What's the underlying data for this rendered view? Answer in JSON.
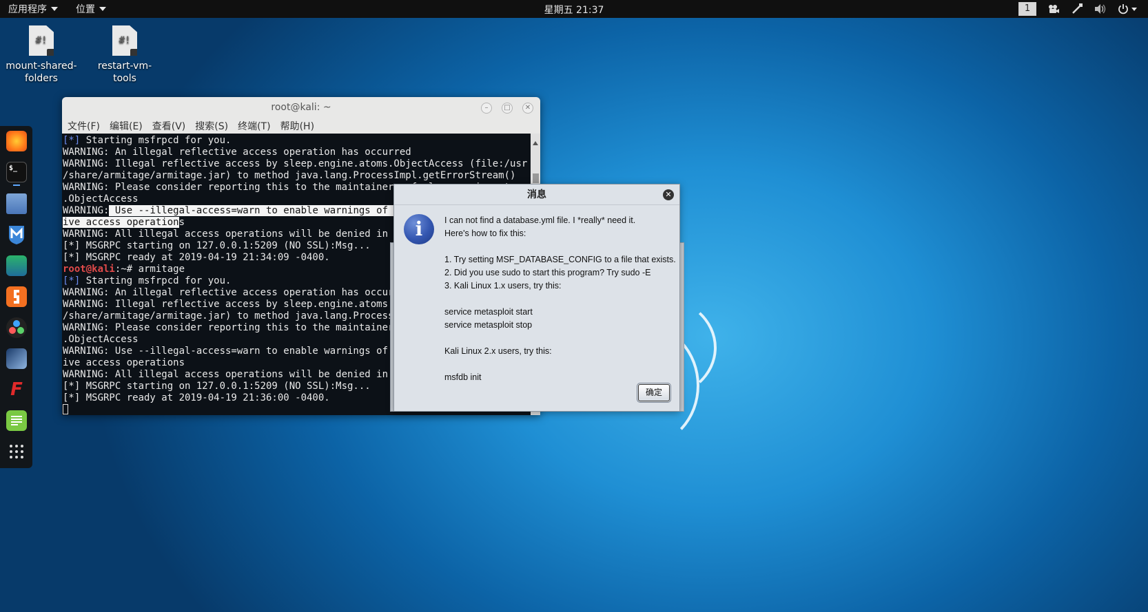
{
  "topbar": {
    "apps_menu": "应用程序",
    "places_menu": "位置",
    "clock": "星期五 21:37",
    "workspace": "1"
  },
  "desktop": {
    "icons": [
      {
        "label": "mount-shared-\nfolders"
      },
      {
        "label": "restart-vm-\ntools"
      }
    ],
    "file_glyph": "#!"
  },
  "terminal": {
    "title": "root@kali: ~",
    "menu": [
      "文件(F)",
      "编辑(E)",
      "查看(V)",
      "搜索(S)",
      "终端(T)",
      "帮助(H)"
    ],
    "lines": [
      {
        "parts": [
          {
            "t": "[*]",
            "c": "blue"
          },
          {
            "t": " Starting msfrpcd for you."
          }
        ]
      },
      {
        "parts": [
          {
            "t": "WARNING: An illegal reflective access operation has occurred"
          }
        ]
      },
      {
        "parts": [
          {
            "t": "WARNING: Illegal reflective access by sleep.engine.atoms.ObjectAccess (file:/usr"
          }
        ]
      },
      {
        "parts": [
          {
            "t": "/share/armitage/armitage.jar) to method java.lang.ProcessImpl.getErrorStream()"
          }
        ]
      },
      {
        "parts": [
          {
            "t": "WARNING: Please consider reporting this to the maintainers of sleep.engine.atoms"
          }
        ]
      },
      {
        "parts": [
          {
            "t": ".ObjectAccess"
          }
        ]
      },
      {
        "parts": [
          {
            "t": "WARNING:"
          },
          {
            "t": " Use --illegal-access=warn to enable warnings of further illegal reflect",
            "c": "sel"
          }
        ]
      },
      {
        "parts": [
          {
            "t": "ive access operation",
            "c": "sel"
          },
          {
            "t": "s"
          }
        ]
      },
      {
        "parts": [
          {
            "t": "WARNING: All illegal access operations will be denied in a future release"
          }
        ]
      },
      {
        "parts": [
          {
            "t": "[*] MSGRPC starting on 127.0.0.1:5209 (NO SSL):Msg..."
          }
        ]
      },
      {
        "parts": [
          {
            "t": "[*] MSGRPC ready at 2019-04-19 21:34:09 -0400."
          }
        ]
      },
      {
        "parts": [
          {
            "t": "root@kali",
            "c": "red"
          },
          {
            "t": ":~# armitage"
          }
        ]
      },
      {
        "parts": [
          {
            "t": "[*]",
            "c": "blue"
          },
          {
            "t": " Starting msfrpcd for you."
          }
        ]
      },
      {
        "parts": [
          {
            "t": "WARNING: An illegal reflective access operation has occurred"
          }
        ]
      },
      {
        "parts": [
          {
            "t": "WARNING: Illegal reflective access by sleep.engine.atoms.ObjectAccess (file:/usr"
          }
        ]
      },
      {
        "parts": [
          {
            "t": "/share/armitage/armitage.jar) to method java.lang.ProcessImpl.getErrorStream()"
          }
        ]
      },
      {
        "parts": [
          {
            "t": "WARNING: Please consider reporting this to the maintainers of sleep.engine.atoms"
          }
        ]
      },
      {
        "parts": [
          {
            "t": ".ObjectAccess"
          }
        ]
      },
      {
        "parts": [
          {
            "t": "WARNING: Use --illegal-access=warn to enable warnings of further illegal reflect"
          }
        ]
      },
      {
        "parts": [
          {
            "t": "ive access operations"
          }
        ]
      },
      {
        "parts": [
          {
            "t": "WARNING: All illegal access operations will be denied in a future release"
          }
        ]
      },
      {
        "parts": [
          {
            "t": "[*] MSGRPC starting on 127.0.0.1:5209 (NO SSL):Msg..."
          }
        ]
      },
      {
        "parts": [
          {
            "t": "[*] MSGRPC ready at 2019-04-19 21:36:00 -0400."
          }
        ]
      }
    ]
  },
  "dialog": {
    "title": "消息",
    "message": "I can not find a database.yml file. I *really* need it.\nHere's how to fix this:\n\n1. Try setting MSF_DATABASE_CONFIG to a file that exists.\n2. Did you use sudo to start this program? Try sudo -E\n3. Kali Linux 1.x users, try this:\n\nservice metasploit start\nservice metasploit stop\n\nKali Linux 2.x users, try this:\n\nmsfdb init",
    "ok_label": "确定",
    "icon_glyph": "i"
  },
  "dock_glyphs": {
    "terminal": "$_",
    "flash": "F"
  },
  "colors": {
    "accent_blue": "#6c8cf0",
    "prompt_red": "#e14a4a",
    "topbar": "#101010",
    "terminal_bg": "#0c1117",
    "dialog_bg": "#dde2e8"
  }
}
